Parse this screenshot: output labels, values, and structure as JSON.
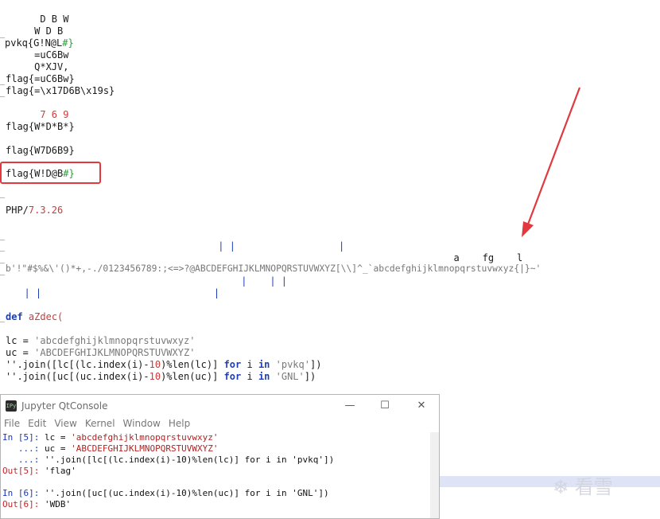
{
  "editor": {
    "lines": {
      "l1": "      D B W",
      "l2": "     W D B",
      "l3a": "pvkq{G!N@L",
      "l3b": "#}",
      "l4": "     =uC6Bw",
      "l5": "     Q*XJV,",
      "l6": "flag{=uC6Bw}",
      "l7": "flag{=\\x17D6B\\x19s}",
      "l8": "      7 6 9",
      "l9": "flag{W*D*B*}",
      "l10": "flag{W7D6B9}",
      "l11a": "flag{W!D@B",
      "l11b": "#}",
      "l12a": "PHP/",
      "l12b": "7.3.26",
      "l13": "                                     | |                  |",
      "l14": "                                                                              a    fg    l",
      "l15": "b'!\"#$%&\\'()*+,-./0123456789:;<=>?@ABCDEFGHIJKLMNOPQRSTUVWXYZ[\\\\]^_`abcdefghijklmnopqrstuvwxyz{|}~'",
      "l16": "                                         |    | |",
      "l17": "  | |                              |",
      "def_kw": "def",
      "def_name": "aZdec(",
      "lc_name": "lc = ",
      "lc_val": "'abcdefghijklmnopqrstuvwxyz'",
      "uc_name": "uc = ",
      "uc_val": "'ABCDEFGHIJKLMNOPQRSTUVWXYZ'",
      "j1a": "''.join([lc[(lc.index(i)-",
      "j1n": "10",
      "j1b": ")%len(lc)] ",
      "j1for": "for",
      "j1c": " i ",
      "j1in": "in",
      "j1s": " 'pvkq'",
      "j1e": "])",
      "j2a": "''.join([uc[(uc.index(i)-",
      "j2n": "10",
      "j2b": ")%len(uc)] ",
      "j2for": "for",
      "j2c": " i ",
      "j2in": "in",
      "j2s": " 'GNL'",
      "j2e": "])"
    },
    "watermark": "看雪"
  },
  "console": {
    "title": "Jupyter QtConsole",
    "icon_text": "IPy",
    "minimize": "—",
    "maximize": "☐",
    "close": "✕",
    "menu": [
      "File",
      "Edit",
      "View",
      "Kernel",
      "Window",
      "Help"
    ],
    "c1p": "In [5]: ",
    "c1a": "lc = ",
    "c1s": "'abcdefghijklmnopqrstuvwxyz'",
    "c2p": "   ...: ",
    "c2a": "uc = ",
    "c2s": "'ABCDEFGHIJKLMNOPQRSTUVWXYZ'",
    "c3p": "   ...: ",
    "c3a": "''.join([lc[(lc.index(i)-10)%len(lc)] for i in 'pvkq'])",
    "c4p": "Out[5]: ",
    "c4s": "'flag'",
    "c5p": "In [6]: ",
    "c5a": "''.join([uc[(uc.index(i)-10)%len(uc)] for i in 'GNL'])",
    "c6p": "Out[6]: ",
    "c6s": "'WDB'"
  },
  "colors": {
    "highlight_box": "#e0393e",
    "arrow": "#e0393e",
    "keyword": "#1f3fb0"
  }
}
